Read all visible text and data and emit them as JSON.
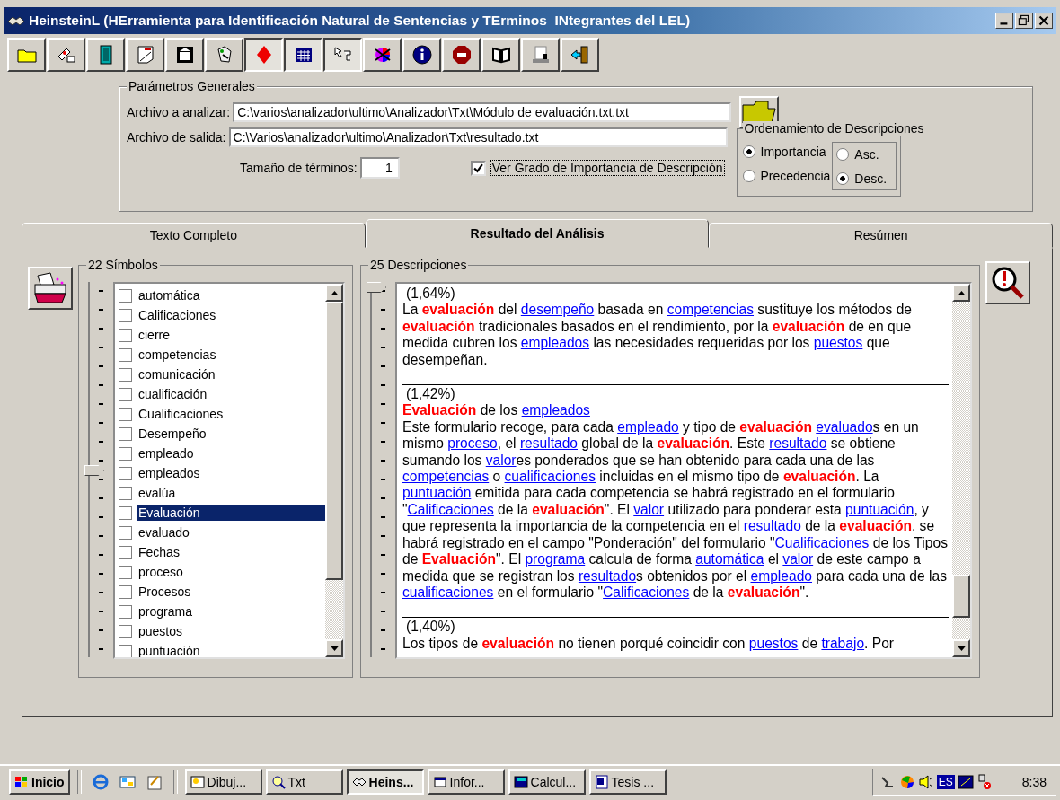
{
  "window": {
    "title": "HeinsteinL (HErramienta para Identificación Natural de Sentencias y TErminos  INtegrantes del LEL)"
  },
  "toolbar": [
    {
      "pressed": false
    },
    {
      "pressed": false
    },
    {
      "pressed": false
    },
    {
      "pressed": false
    },
    {
      "pressed": false
    },
    {
      "pressed": false
    },
    {
      "pressed": true
    },
    {
      "pressed": true
    },
    {
      "pressed": true
    },
    {
      "pressed": false
    },
    {
      "pressed": false
    },
    {
      "pressed": false
    },
    {
      "pressed": false
    },
    {
      "pressed": false
    },
    {
      "pressed": false
    }
  ],
  "parameters": {
    "title": "Parámetros Generales",
    "input_label": "Archivo a analizar:",
    "input_value": "C:\\varios\\analizador\\ultimo\\Analizador\\Txt\\Módulo de evaluación.txt.txt",
    "output_label": "Archivo de salida:",
    "output_value": "C:\\Varios\\analizador\\ultimo\\Analizador\\Txt\\resultado.txt",
    "size_label": "Tamaño de términos:",
    "size_value": "1",
    "show_importance": {
      "label": "Ver Grado de Importancia de Descripción",
      "checked": true
    },
    "ordering": {
      "title": "Ordenamiento de Descripciones",
      "criteria": [
        {
          "label": "Importancia",
          "selected": true
        },
        {
          "label": "Precedencia",
          "selected": false
        }
      ],
      "direction": [
        {
          "label": "Asc.",
          "selected": false
        },
        {
          "label": "Desc.",
          "selected": true
        }
      ]
    }
  },
  "tabs": [
    {
      "label": "Texto Completo",
      "selected": false
    },
    {
      "label": "Resultado del Análisis",
      "selected": true
    },
    {
      "label": "Resúmen",
      "selected": false
    }
  ],
  "symbols": {
    "title": "22 Símbolos",
    "level": 0.5,
    "items": [
      {
        "label": "automática",
        "checked": false,
        "selected": false
      },
      {
        "label": "Calificaciones",
        "checked": false,
        "selected": false
      },
      {
        "label": "cierre",
        "checked": false,
        "selected": false
      },
      {
        "label": "competencias",
        "checked": false,
        "selected": false
      },
      {
        "label": "comunicación",
        "checked": false,
        "selected": false
      },
      {
        "label": "cualificación",
        "checked": false,
        "selected": false
      },
      {
        "label": "Cualificaciones",
        "checked": false,
        "selected": false
      },
      {
        "label": "Desempeño",
        "checked": false,
        "selected": false
      },
      {
        "label": "empleado",
        "checked": false,
        "selected": false
      },
      {
        "label": "empleados",
        "checked": false,
        "selected": false
      },
      {
        "label": "evalúa",
        "checked": false,
        "selected": false
      },
      {
        "label": "Evaluación",
        "checked": false,
        "selected": true
      },
      {
        "label": "evaluado",
        "checked": false,
        "selected": false
      },
      {
        "label": "Fechas",
        "checked": false,
        "selected": false
      },
      {
        "label": "proceso",
        "checked": false,
        "selected": false
      },
      {
        "label": "Procesos",
        "checked": false,
        "selected": false
      },
      {
        "label": "programa",
        "checked": false,
        "selected": false
      },
      {
        "label": "puestos",
        "checked": false,
        "selected": false
      },
      {
        "label": "puntuación",
        "checked": false,
        "selected": false
      }
    ]
  },
  "descriptions": {
    "title": "25 Descripciones",
    "level": 0,
    "items": [
      {
        "score": "(1,64%)",
        "paragraphs": [
          [
            {
              "text": "La "
            },
            {
              "term": "evaluación"
            },
            {
              "text": " del "
            },
            {
              "link": "desempeño"
            },
            {
              "text": " basada en "
            },
            {
              "link": "competencias"
            },
            {
              "text": " sustituye los métodos de "
            },
            {
              "term": "evaluación"
            },
            {
              "text": " tradicionales basados en el rendimiento, por la "
            },
            {
              "term": "evaluación"
            },
            {
              "text": " de en que medida cubren los "
            },
            {
              "link": "empleados"
            },
            {
              "text": " las necesidades requeridas por los "
            },
            {
              "link": "puestos"
            },
            {
              "text": " que desempeñan."
            }
          ]
        ]
      },
      {
        "score": "(1,42%)",
        "paragraphs": [
          [
            {
              "term": "Evaluación"
            },
            {
              "text": " de los "
            },
            {
              "link": "empleados"
            }
          ],
          [
            {
              "text": "Este formulario recoge, para cada "
            },
            {
              "link": "empleado"
            },
            {
              "text": " y tipo de "
            },
            {
              "term": "evaluación "
            },
            {
              "link": "evaluado"
            },
            {
              "text": "s en un mismo "
            },
            {
              "link": "proceso"
            },
            {
              "text": ", el "
            },
            {
              "link": "resultado"
            },
            {
              "text": " global de la "
            },
            {
              "term": "evaluación"
            },
            {
              "text": ". Este "
            },
            {
              "link": "resultado"
            },
            {
              "text": " se obtiene sumando los "
            },
            {
              "link": "valor"
            },
            {
              "text": "es ponderados que se han obtenido para cada una de las "
            },
            {
              "link": "competencias"
            },
            {
              "text": " o "
            },
            {
              "link": "cualificaciones"
            },
            {
              "text": " incluidas en el mismo tipo de "
            },
            {
              "term": "evaluación"
            },
            {
              "text": ". La "
            },
            {
              "link": "puntuación"
            },
            {
              "text": " emitida para cada competencia se habrá registrado en el formulario \""
            },
            {
              "link": "Calificaciones"
            },
            {
              "text": " de la "
            },
            {
              "term": "evaluación"
            },
            {
              "text": "\". El "
            },
            {
              "link": "valor"
            },
            {
              "text": " utilizado para ponderar esta "
            },
            {
              "link": "puntuación"
            },
            {
              "text": ", y que representa la importancia de la competencia en el "
            },
            {
              "link": "resultado"
            },
            {
              "text": " de la "
            },
            {
              "term": "evaluación"
            },
            {
              "text": ", se habrá registrado en el campo \"Ponderación\" del formulario \""
            },
            {
              "link": "Cualificaciones"
            },
            {
              "text": " de los Tipos de "
            },
            {
              "term": "Evaluación"
            },
            {
              "text": "\". El "
            },
            {
              "link": "programa"
            },
            {
              "text": " calcula de forma "
            },
            {
              "link": "automática"
            },
            {
              "text": " el "
            },
            {
              "link": "valor"
            },
            {
              "text": " de este campo a medida que se registran los "
            },
            {
              "link": "resultado"
            },
            {
              "text": "s obtenidos por el "
            },
            {
              "link": "empleado"
            },
            {
              "text": " para cada una de las "
            },
            {
              "link": "cualificaciones"
            },
            {
              "text": " en el formulario \""
            },
            {
              "link": "Calificaciones"
            },
            {
              "text": " de la "
            },
            {
              "term": "evaluación"
            },
            {
              "text": "\"."
            }
          ]
        ]
      },
      {
        "score": "(1,40%)",
        "paragraphs": [
          [
            {
              "text": "Los tipos de "
            },
            {
              "term": "evaluación"
            },
            {
              "text": " no tienen porqué coincidir con "
            },
            {
              "link": "puestos"
            },
            {
              "text": " de "
            },
            {
              "link": "trabajo"
            },
            {
              "text": ". Por"
            }
          ]
        ]
      }
    ]
  },
  "taskbar": {
    "start": "Inicio",
    "tasks": [
      {
        "label": "Dibuj...",
        "selected": false
      },
      {
        "label": "Txt",
        "selected": false
      },
      {
        "label": "Heins...",
        "selected": true
      },
      {
        "label": "Infor...",
        "selected": false
      },
      {
        "label": "Calcul...",
        "selected": false
      },
      {
        "label": "Tesis ...",
        "selected": false
      }
    ],
    "language": "ES",
    "time": "8:38"
  }
}
